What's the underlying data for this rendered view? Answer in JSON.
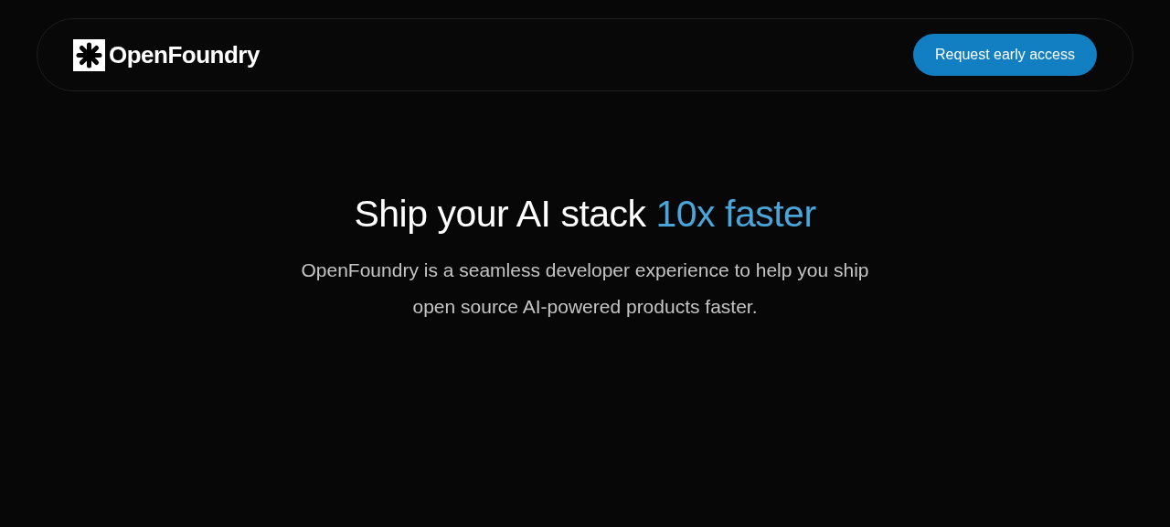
{
  "header": {
    "logo_text": "OpenFoundry",
    "cta": "Request early access"
  },
  "hero": {
    "title": "Ship your AI stack ",
    "title_highlight": "10x faster",
    "subtitle": "OpenFoundry is a seamless developer experience to help you ship open source AI-powered products faster."
  }
}
